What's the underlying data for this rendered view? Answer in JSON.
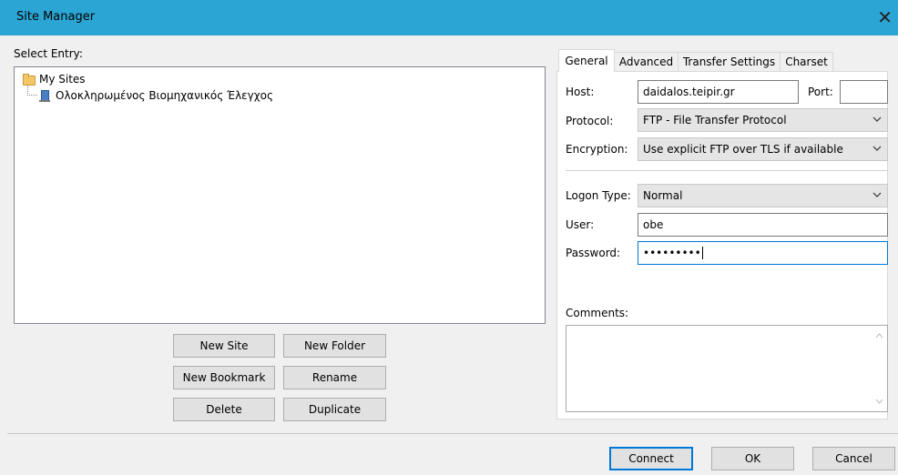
{
  "window": {
    "title": "Site Manager",
    "close_glyph": "✕"
  },
  "left": {
    "select_entry_label": "Select Entry:",
    "tree": {
      "root": "My Sites",
      "site": "Ολοκληρωμένος Βιομηχανικός Έλεγχος"
    },
    "buttons": {
      "new_site": "New Site",
      "new_folder": "New Folder",
      "new_bookmark": "New Bookmark",
      "rename": "Rename",
      "delete": "Delete",
      "duplicate": "Duplicate"
    }
  },
  "tabs": [
    {
      "label": "General",
      "active": true
    },
    {
      "label": "Advanced",
      "active": false
    },
    {
      "label": "Transfer Settings",
      "active": false
    },
    {
      "label": "Charset",
      "active": false
    }
  ],
  "general": {
    "host_label": "Host:",
    "host_value": "daidalos.teipir.gr",
    "port_label": "Port:",
    "port_value": "",
    "protocol_label": "Protocol:",
    "protocol_value": "FTP - File Transfer Protocol",
    "encryption_label": "Encryption:",
    "encryption_value": "Use explicit FTP over TLS if available",
    "logon_type_label": "Logon Type:",
    "logon_type_value": "Normal",
    "user_label": "User:",
    "user_value": "obe",
    "password_label": "Password:",
    "password_value": "•••••••••",
    "comments_label": "Comments:"
  },
  "footer": {
    "connect": "Connect",
    "ok": "OK",
    "cancel": "Cancel"
  },
  "colors": {
    "titlebar": "#2ba5d4",
    "focus": "#0078d7"
  }
}
